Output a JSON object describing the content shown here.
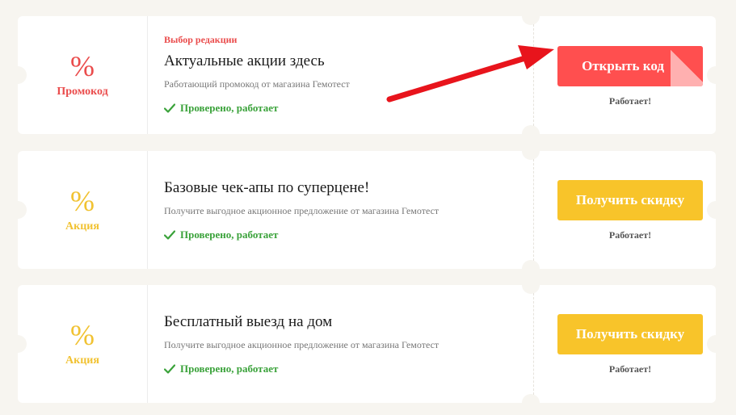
{
  "colors": {
    "accent_red": "#ff4f4f",
    "accent_yellow": "#f8c42a",
    "success_green": "#3aa23a",
    "background": "#f7f5f0",
    "annotation_arrow": "#e8141c"
  },
  "offers": [
    {
      "percent": "%",
      "type_label": "Промокод",
      "badge": "Выбор редакции",
      "title": "Актуальные акции здесь",
      "description": "Работающий промокод от магазина Гемотест",
      "verified": "Проверено, работает",
      "button_label": "Открыть код",
      "status": "Работает!"
    },
    {
      "percent": "%",
      "type_label": "Акция",
      "title": "Базовые чек-апы по суперцене!",
      "description": "Получите выгодное акционное предложение от магазина Гемотест",
      "verified": "Проверено, работает",
      "button_label": "Получить скидку",
      "status": "Работает!"
    },
    {
      "percent": "%",
      "type_label": "Акция",
      "title": "Бесплатный выезд на дом",
      "description": "Получите выгодное акционное предложение от магазина Гемотест",
      "verified": "Проверено, работает",
      "button_label": "Получить скидку",
      "status": "Работает!"
    }
  ],
  "icons": {
    "verified": "check-icon",
    "annotation": "red-arrow-icon"
  }
}
